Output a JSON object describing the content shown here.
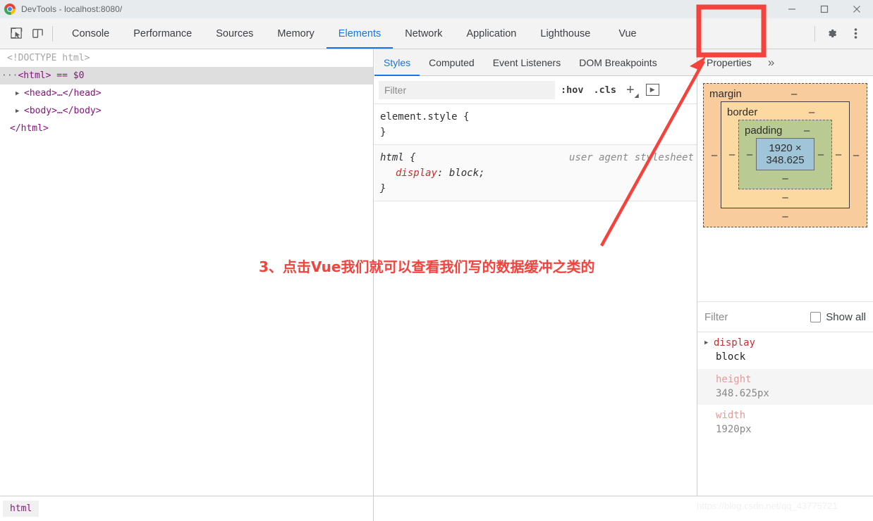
{
  "window": {
    "title": "DevTools - localhost:8080/",
    "logo_icon": "chrome-logo-icon",
    "minimize_icon": "minimize-icon",
    "maximize_icon": "maximize-icon",
    "close_icon": "close-icon"
  },
  "toolbar": {
    "inspect_icon": "inspect-element-icon",
    "device_icon": "device-toolbar-icon",
    "settings_icon": "gear-icon",
    "more_icon": "kebab-menu-icon",
    "tabs": [
      {
        "label": "Console",
        "active": false
      },
      {
        "label": "Performance",
        "active": false
      },
      {
        "label": "Sources",
        "active": false
      },
      {
        "label": "Memory",
        "active": false
      },
      {
        "label": "Elements",
        "active": true
      },
      {
        "label": "Network",
        "active": false
      },
      {
        "label": "Application",
        "active": false
      },
      {
        "label": "Lighthouse",
        "active": false
      },
      {
        "label": "Vue",
        "active": false
      }
    ]
  },
  "dom_tree": {
    "rows": [
      {
        "indent": 0,
        "twisty": "",
        "text": "<!DOCTYPE html>",
        "type": "doctype",
        "selected": false
      },
      {
        "indent": 0,
        "twisty": "",
        "text": "<html> == $0",
        "type": "element",
        "selected": true
      },
      {
        "indent": 1,
        "twisty": "▶",
        "text": "<head>…</head>",
        "type": "element",
        "selected": false
      },
      {
        "indent": 1,
        "twisty": "▶",
        "text": "<body>…</body>",
        "type": "element",
        "selected": false
      },
      {
        "indent": 1,
        "twisty": "",
        "text": "</html>",
        "type": "element",
        "selected": false
      }
    ],
    "selected_marker": "···",
    "dollar_zero": "$0"
  },
  "breadcrumb": {
    "items": [
      "html"
    ]
  },
  "styles_pane": {
    "tabs": [
      {
        "label": "Styles",
        "active": true
      },
      {
        "label": "Computed",
        "active": false
      },
      {
        "label": "Event Listeners",
        "active": false
      },
      {
        "label": "DOM Breakpoints",
        "active": false
      },
      {
        "label": "Properties",
        "active": false
      }
    ],
    "overflow_icon": "chevron-double-right-icon",
    "filter_placeholder": "Filter",
    "filter_value": "",
    "hov_label": ":hov",
    "cls_label": ".cls",
    "add_rule_label": "+",
    "toggle_element_state_icon": "render-box-icon",
    "rules": [
      {
        "selector": "element.style {",
        "close": "}",
        "origin": "",
        "declarations": []
      },
      {
        "selector": "html {",
        "close": "}",
        "origin": "user agent stylesheet",
        "declarations": [
          {
            "name": "display",
            "value": "block;"
          }
        ]
      }
    ]
  },
  "computed_pane": {
    "box_model": {
      "margin_label": "margin",
      "margin_value": "–",
      "border_label": "border",
      "border_value": "–",
      "padding_label": "padding",
      "padding_value": "–",
      "content_size": "1920 × 348.625",
      "dash": "–"
    },
    "filter_placeholder": "Filter",
    "show_all_label": "Show all",
    "show_all_checked": false,
    "properties": [
      {
        "name": "display",
        "value": "block",
        "expandable": true,
        "faded": false,
        "alt": false
      },
      {
        "name": "height",
        "value": "348.625px",
        "expandable": false,
        "faded": true,
        "alt": true
      },
      {
        "name": "width",
        "value": "1920px",
        "expandable": false,
        "faded": true,
        "alt": false
      }
    ]
  },
  "annotations": {
    "callout_text": "3、点击Vue我们就可以查看我们写的数据缓冲之类的",
    "highlight_target": "Vue",
    "accent_color": "#f4433d"
  },
  "watermark": {
    "text": "https://blog.csdn.net/qq_43775721"
  }
}
